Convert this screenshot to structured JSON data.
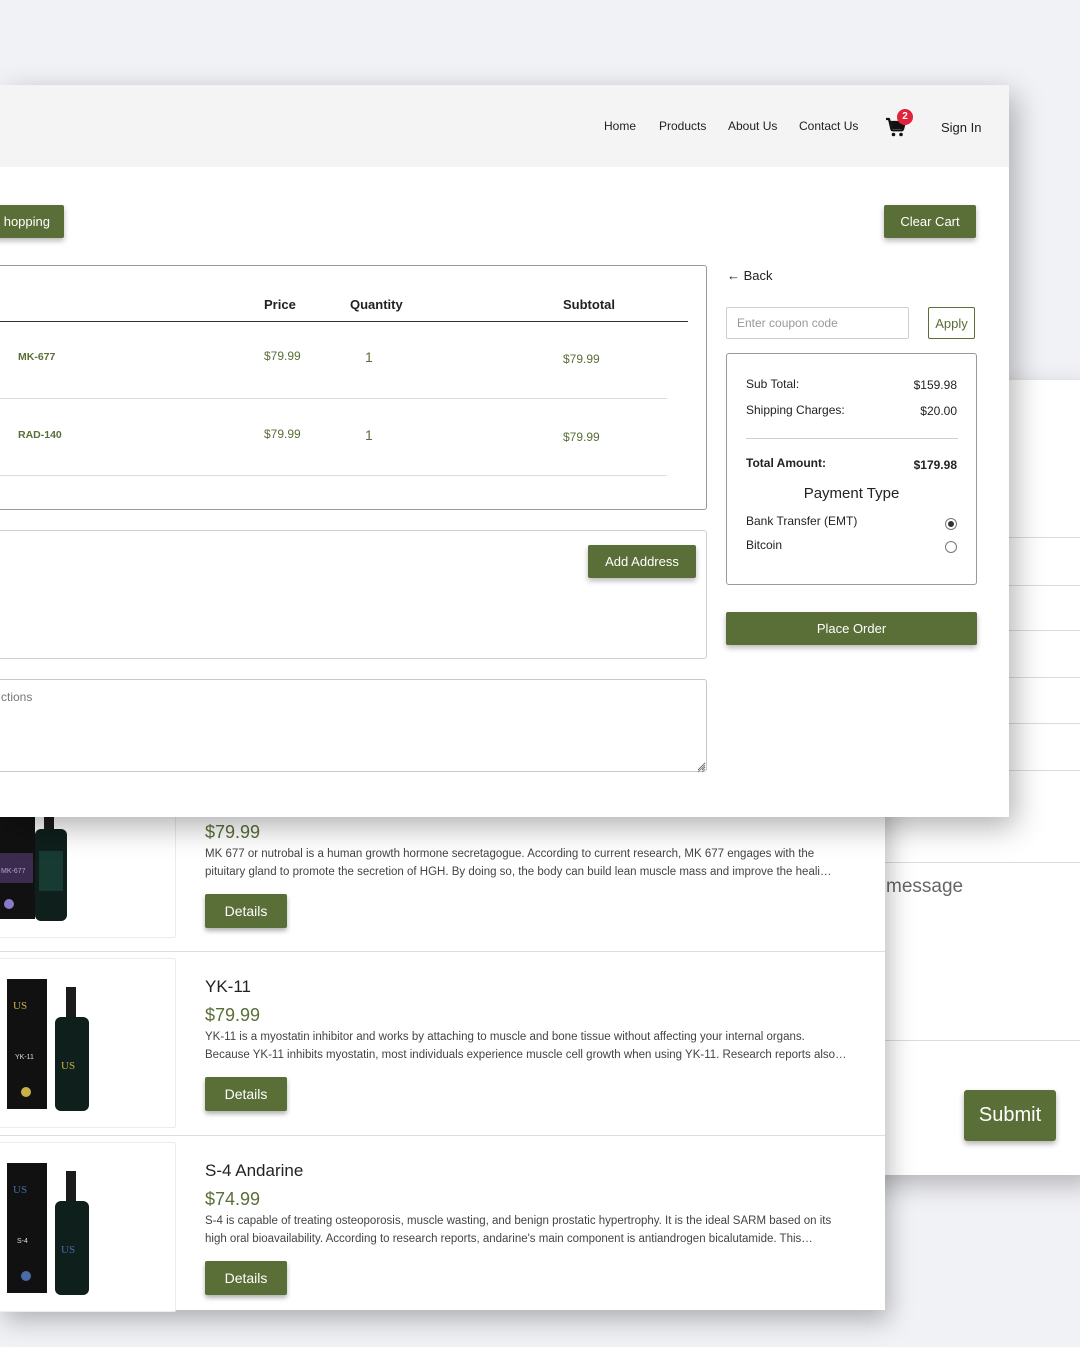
{
  "contact_form": {
    "message_placeholder": "message",
    "submit_label": "Submit"
  },
  "product_list": {
    "details_label": "Details",
    "items": [
      {
        "name": "",
        "price": "$79.99",
        "desc_line1": "MK 677 or nutrobal is a human growth hormone secretagogue. According to current research, MK 677 engages with the",
        "desc_line2": "pituitary gland to promote the secretion of HGH. By doing so, the body can build lean muscle mass and improve the heali…",
        "image_label": "MK-677"
      },
      {
        "name": "YK-11",
        "price": "$79.99",
        "desc_line1": "YK-11 is a myostatin inhibitor and works by attaching to muscle and bone tissue without affecting your internal organs.",
        "desc_line2": "Because YK-11 inhibits myostatin, most individuals experience muscle cell growth when using YK-11. Research reports also…",
        "image_label": "YK-11"
      },
      {
        "name": "S-4 Andarine",
        "price": "$74.99",
        "desc_line1": "S-4 is capable of treating osteoporosis, muscle wasting, and benign prostatic hypertrophy. It is the ideal SARM based on its",
        "desc_line2": "high oral bioavailability. According to research reports, andarine's main component is antiandrogen bicalutamide. This…",
        "image_label": "S-4"
      }
    ]
  },
  "nav": {
    "links": [
      "Home",
      "Products",
      "About Us",
      "Contact Us"
    ],
    "cart_count": "2",
    "sign_in": "Sign In"
  },
  "cart": {
    "continue_label": "hopping",
    "clear_label": "Clear Cart",
    "columns": {
      "price": "Price",
      "quantity": "Quantity",
      "subtotal": "Subtotal"
    },
    "rows": [
      {
        "name": "MK-677",
        "price": "$79.99",
        "qty": "1",
        "subtotal": "$79.99"
      },
      {
        "name": "RAD-140",
        "price": "$79.99",
        "qty": "1",
        "subtotal": "$79.99"
      }
    ],
    "add_address_label": "Add Address",
    "instructions_placeholder": "ctions"
  },
  "checkout": {
    "back_label": "Back",
    "coupon_placeholder": "Enter coupon code",
    "apply_label": "Apply",
    "sub_total_label": "Sub Total:",
    "sub_total_value": "$159.98",
    "shipping_label": "Shipping Charges:",
    "shipping_value": "$20.00",
    "total_label": "Total Amount:",
    "total_value": "$179.98",
    "payment_title": "Payment Type",
    "payment_options": [
      {
        "label": "Bank Transfer (EMT)",
        "selected": true
      },
      {
        "label": "Bitcoin",
        "selected": false
      }
    ],
    "place_order_label": "Place Order"
  },
  "colors": {
    "accent": "#5a6e37",
    "badge": "#e0233a"
  }
}
